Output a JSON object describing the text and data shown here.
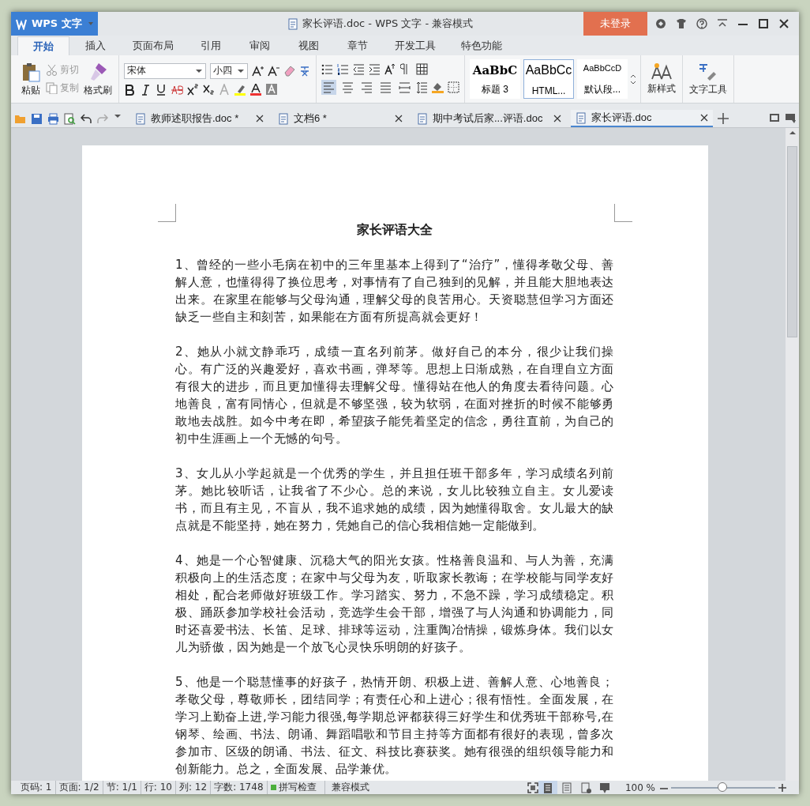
{
  "window": {
    "app_button": "WPS 文字",
    "title": "家长评语.doc - WPS 文字 - 兼容模式",
    "login": "未登录"
  },
  "tabs": [
    {
      "label": "开始",
      "selected": true
    },
    {
      "label": "插入",
      "selected": false
    },
    {
      "label": "页面布局",
      "selected": false
    },
    {
      "label": "引用",
      "selected": false
    },
    {
      "label": "审阅",
      "selected": false
    },
    {
      "label": "视图",
      "selected": false
    },
    {
      "label": "章节",
      "selected": false
    },
    {
      "label": "开发工具",
      "selected": false
    },
    {
      "label": "特色功能",
      "selected": false
    }
  ],
  "ribbon": {
    "paste": "粘贴",
    "cut": {
      "label": "剪切",
      "disabled": true
    },
    "copy": {
      "label": "复制",
      "disabled": true
    },
    "format_painter": "格式刷",
    "font": {
      "name": "宋体",
      "size": "小四"
    },
    "align": [
      {
        "selected": true
      },
      {
        "selected": false
      },
      {
        "selected": false
      },
      {
        "selected": false
      },
      {
        "selected": false
      }
    ],
    "styles": [
      {
        "sample": "AaBbC",
        "label": "标题 3",
        "kind": "heading",
        "selected": false
      },
      {
        "sample": "AaBbCc",
        "label": "HTML...",
        "kind": "html",
        "selected": true
      },
      {
        "sample": "AaBbCcD",
        "label": "默认段...",
        "kind": "normal",
        "selected": false
      }
    ],
    "new_style": "新样式",
    "text_tools": "文字工具"
  },
  "doc_tabs": [
    {
      "label": "教师述职报告.doc *",
      "selected": false
    },
    {
      "label": "文档6 *",
      "selected": false
    },
    {
      "label": "期中考试后家...评语.doc",
      "selected": false
    },
    {
      "label": "家长评语.doc",
      "selected": true
    }
  ],
  "document": {
    "title": "家长评语大全",
    "paragraphs": [
      "1、曾经的一些小毛病在初中的三年里基本上得到了“治疗”，懂得孝敬父母、善解人意，也懂得得了换位思考，对事情有了自己独到的见解，并且能大胆地表达出来。在家里在能够与父母沟通，理解父母的良苦用心。天资聪慧但学习方面还缺乏一些自主和刻苦，如果能在方面有所提高就会更好！",
      "2、她从小就文静乖巧，成绩一直名列前茅。做好自己的本分，很少让我们操心。有广泛的兴趣爱好，喜欢书画，弹琴等。思想上日渐成熟，在自理自立方面有很大的进步，而且更加懂得去理解父母。懂得站在他人的角度去看待问题。心地善良，富有同情心，但就是不够坚强，较为软弱，在面对挫折的时候不能够勇敢地去战胜。如今中考在即，希望孩子能凭着坚定的信念，勇往直前，为自己的初中生涯画上一个无憾的句号。",
      "3、女儿从小学起就是一个优秀的学生，并且担任班干部多年，学习成绩名列前茅。她比较听话，让我省了不少心。总的来说，女儿比较独立自主。女儿爱读书，而且有主见，不盲从，我不追求她的成绩，因为她懂得取舍。女儿最大的缺点就是不能坚持，她在努力，凭她自己的信心我相信她一定能做到。",
      "4、她是一个心智健康、沉稳大气的阳光女孩。性格善良温和、与人为善，充满积极向上的生活态度；在家中与父母为友，听取家长教诲；在学校能与同学友好相处，配合老师做好班级工作。学习踏实、努力，不急不躁，学习成绩稳定。积极、踊跃参加学校社会活动，竞选学生会干部，增强了与人沟通和协调能力，同时还喜爱书法、长笛、足球、排球等运动，注重陶冶情操，锻炼身体。我们以女儿为骄傲，因为她是一个放飞心灵快乐明朗的好孩子。",
      "5、他是一个聪慧懂事的好孩子，热情开朗、积极上进、善解人意、心地善良；孝敬父母，尊敬师长，团结同学；有责任心和上进心；很有悟性。全面发展，在学习上勤奋上进,学习能力很强,每学期总评都获得三好学生和优秀班干部称号,在钢琴、绘画、书法、朗诵、舞蹈唱歌和节目主持等方面都有很好的表现，曾多次参加市、区级的朗诵、书法、征文、科技比赛获奖。她有很强的组织领导能力和创新能力。总之，全面发展、品学兼优。"
    ]
  },
  "status_bar": {
    "fields": [
      "页码: 1",
      "页面: 1/2",
      "节: 1/1",
      "行: 10",
      "列: 12",
      "字数: 1748"
    ],
    "spell_check": {
      "label": "拼写检查",
      "on": true
    },
    "mode": "兼容模式",
    "views": [
      {
        "selected": true
      },
      {
        "selected": false
      },
      {
        "selected": false
      },
      {
        "selected": false
      }
    ],
    "zoom": "100 %",
    "zoom_level": {
      "level": 0.5
    }
  }
}
